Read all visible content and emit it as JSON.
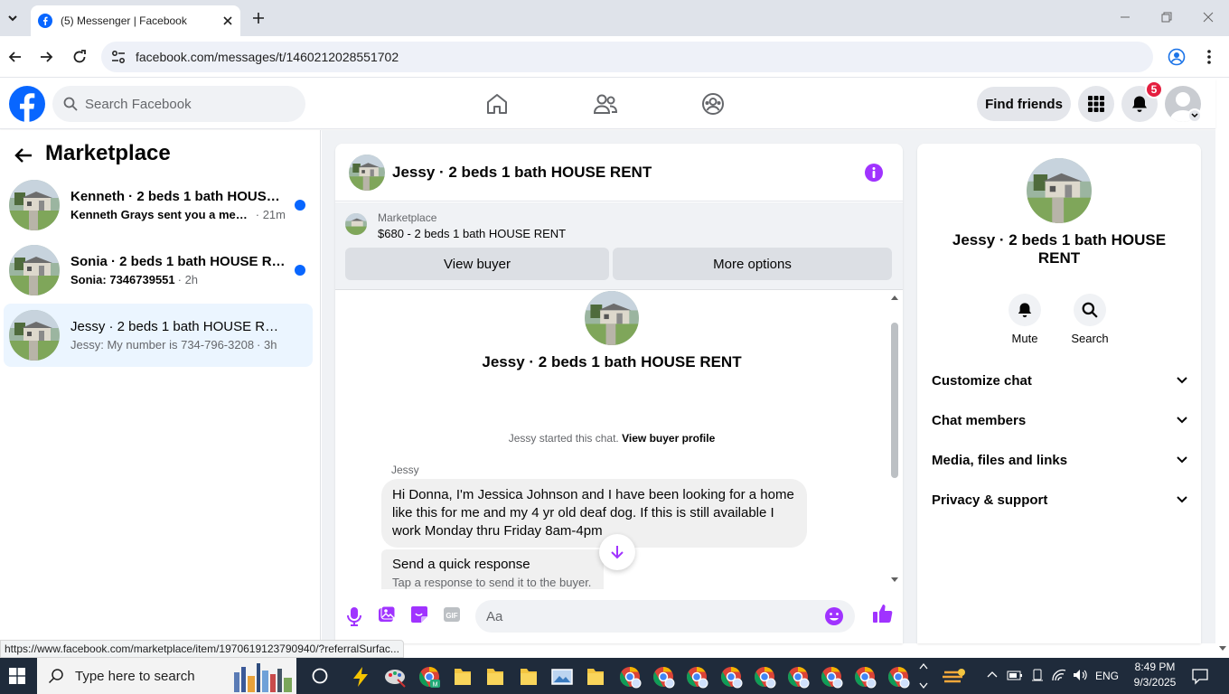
{
  "browser": {
    "tab_title": "(5) Messenger | Facebook",
    "url": "facebook.com/messages/t/1460212028551702",
    "status_url": "https://www.facebook.com/marketplace/item/1970619123790940/?referralSurfac..."
  },
  "header": {
    "search_placeholder": "Search Facebook",
    "find_friends": "Find friends",
    "notification_count": "5"
  },
  "sidebar": {
    "title": "Marketplace",
    "threads": [
      {
        "name": "Kenneth · 2 beds 1 bath HOUSE ...",
        "preview": "Kenneth Grays sent you a messa...",
        "time": "· 21m",
        "unread": true
      },
      {
        "name": "Sonia · 2 beds 1 bath HOUSE RENT",
        "preview": "Sonia: 7346739551",
        "time": "· 2h",
        "unread": true
      },
      {
        "name": "Jessy · 2 beds 1 bath HOUSE RENT",
        "preview": "Jessy: My number is 734-796-3208",
        "time": "· 3h",
        "unread": false
      }
    ]
  },
  "chat": {
    "title": "Jessy · 2 beds 1 bath HOUSE RENT",
    "marketplace_label": "Marketplace",
    "listing": "$680 - 2 beds 1 bath HOUSE RENT",
    "view_buyer": "View buyer",
    "more_options": "More options",
    "convo_name": "Jessy · 2 beds 1 bath HOUSE RENT",
    "started_text": "Jessy started this chat.",
    "view_buyer_profile": "View buyer profile",
    "sender": "Jessy",
    "message": "Hi Donna, I'm Jessica Johnson and I have been looking for a home like this for me and my 4 yr old deaf dog. If this is still available I work Monday thru Friday 8am-4pm",
    "quick_response_title": "Send a quick response",
    "quick_response_sub": "Tap a response to send it to the buyer.",
    "input_placeholder": "Aa"
  },
  "info_panel": {
    "name": "Jessy · 2 beds 1 bath HOUSE RENT",
    "mute": "Mute",
    "search": "Search",
    "sections": [
      "Customize chat",
      "Chat members",
      "Media, files and links",
      "Privacy & support"
    ]
  },
  "taskbar": {
    "search_placeholder": "Type here to search",
    "language": "ENG",
    "time": "8:49 PM",
    "date": "9/3/2025"
  },
  "colors": {
    "fb_blue": "#0866ff",
    "messenger_purple": "#a033ff",
    "unread_dot": "#0866ff",
    "badge_red": "#e41e3f"
  }
}
